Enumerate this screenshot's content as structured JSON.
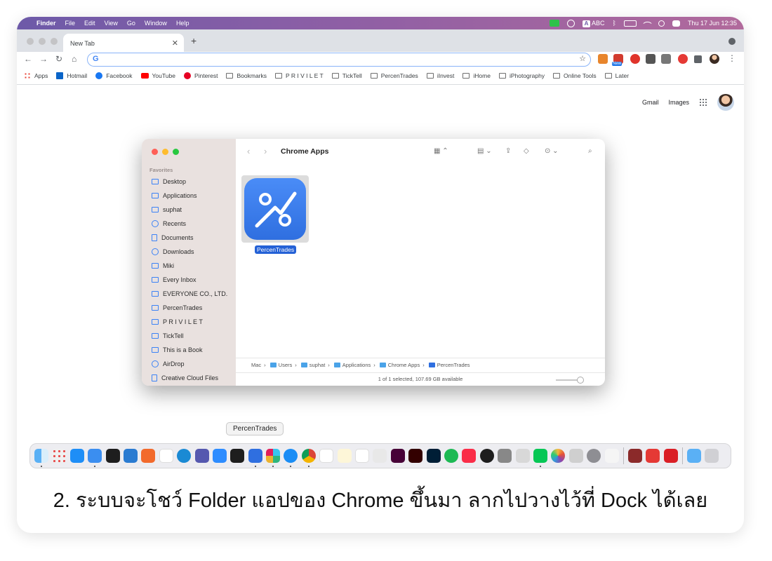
{
  "menubar": {
    "items": [
      "Finder",
      "File",
      "Edit",
      "View",
      "Go",
      "Window",
      "Help"
    ],
    "input_label": "A",
    "input_source": "ABC",
    "datetime": "Thu 17 Jun  12:35"
  },
  "chrome": {
    "tab_title": "New Tab",
    "new_tab": "+",
    "omnibox_icon": "G",
    "ext_badge": "New",
    "bookmarks": [
      "Apps",
      "Hotmail",
      "Facebook",
      "YouTube",
      "Pinterest",
      "Bookmarks",
      "P R I V I L E T",
      "TickTell",
      "PercenTrades",
      "iInvest",
      "iHome",
      "iPhotography",
      "Online Tools",
      "Later"
    ],
    "google_links": [
      "Gmail",
      "Images"
    ]
  },
  "finder": {
    "title": "Chrome Apps",
    "favorites_label": "Favorites",
    "sidebar": [
      {
        "label": "Desktop",
        "icon": "desktop-icon"
      },
      {
        "label": "Applications",
        "icon": "applications-icon"
      },
      {
        "label": "suphat",
        "icon": "home-icon"
      },
      {
        "label": "Recents",
        "icon": "clock-icon"
      },
      {
        "label": "Documents",
        "icon": "document-icon"
      },
      {
        "label": "Downloads",
        "icon": "download-icon"
      },
      {
        "label": "Miki",
        "icon": "folder-icon"
      },
      {
        "label": "Every Inbox",
        "icon": "folder-icon"
      },
      {
        "label": "EVERYONE CO., LTD.",
        "icon": "folder-icon"
      },
      {
        "label": "PercenTrades",
        "icon": "folder-icon"
      },
      {
        "label": "P R I V I L E T",
        "icon": "folder-icon"
      },
      {
        "label": "TickTell",
        "icon": "folder-icon"
      },
      {
        "label": "This is a Book",
        "icon": "folder-icon"
      },
      {
        "label": "AirDrop",
        "icon": "airdrop-icon"
      },
      {
        "label": "Creative Cloud Files",
        "icon": "file-icon"
      }
    ],
    "app_label": "PercenTrades",
    "path": [
      "Mac",
      "Users",
      "suphat",
      "Applications",
      "Chrome Apps",
      "PercenTrades"
    ],
    "path_sep": "›",
    "status": "1 of 1 selected, 107.69 GB available"
  },
  "dock": {
    "tooltip": "PercenTrades"
  },
  "caption": "2. ระบบจะโชว์ Folder แอปของ Chrome ขึ้นมา ลากไปวางไว้ที่ Dock ได้เลย"
}
